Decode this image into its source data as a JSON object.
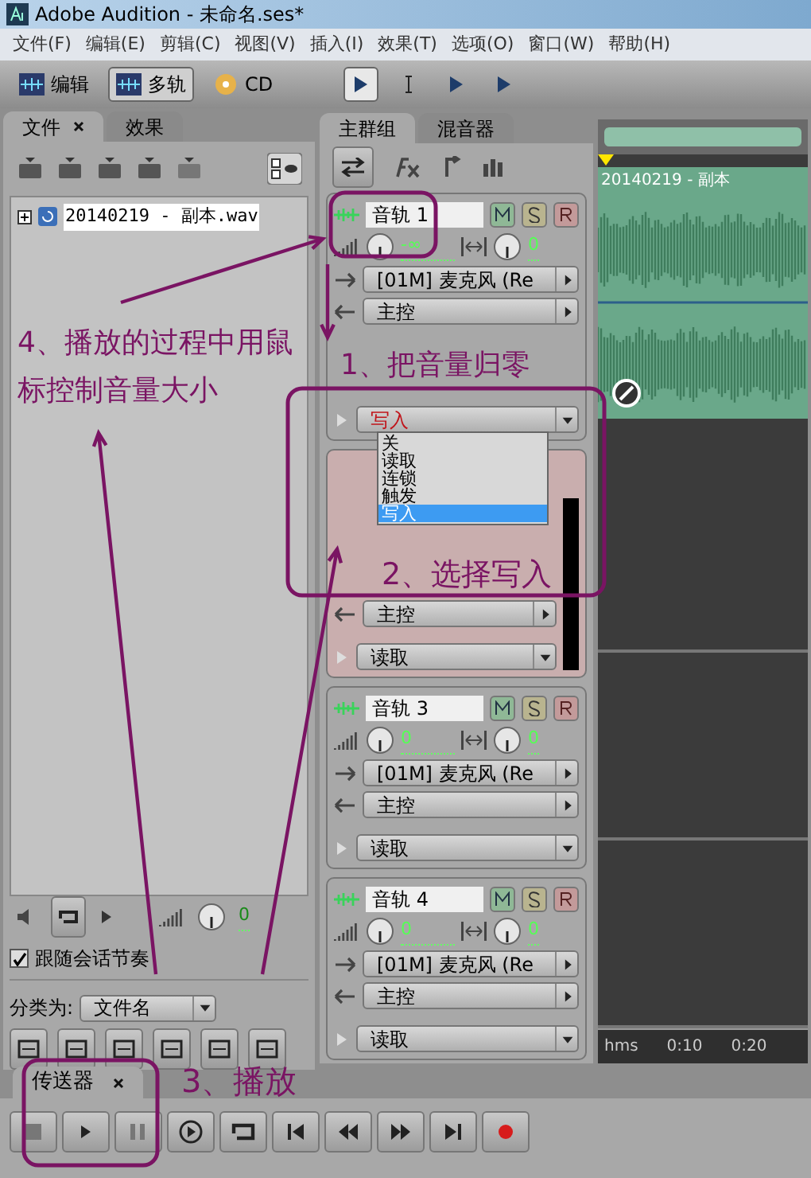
{
  "window": {
    "title": "Adobe Audition - 未命名.ses*"
  },
  "menu": [
    "文件(F)",
    "编辑(E)",
    "剪辑(C)",
    "视图(V)",
    "插入(I)",
    "效果(T)",
    "选项(O)",
    "窗口(W)",
    "帮助(H)"
  ],
  "workspaces": [
    {
      "label": "编辑",
      "selected": false
    },
    {
      "label": "多轨",
      "selected": true
    },
    {
      "label": "CD",
      "selected": false
    }
  ],
  "tools": [
    {
      "selected": true
    },
    {
      "selected": false
    },
    {
      "selected": false
    },
    {
      "selected": false
    }
  ],
  "files_panel": {
    "tabs": [
      {
        "label": "文件",
        "selected": true
      },
      {
        "label": "效果",
        "selected": false
      }
    ],
    "files": [
      {
        "name": "20140219 - 副本.wav",
        "expanded": false
      }
    ],
    "annotation": "4、播放的过程中用鼠标控制音量大小",
    "preview_volume": "0",
    "follow_tempo": {
      "label": "跟随会话节奏",
      "checked": true
    },
    "sort": {
      "label": "分类为:",
      "value": "文件名"
    }
  },
  "tracks_panel": {
    "tabs": [
      {
        "label": "主群组",
        "selected": true
      },
      {
        "label": "混音器",
        "selected": false
      }
    ],
    "tracks": [
      {
        "name": "音轨 1",
        "volume": "-∞",
        "pan": "0",
        "input": "[01M] 麦克风 (Re",
        "output": "主控",
        "annotation": "1、把音量归零",
        "automation": "写入",
        "writing": true,
        "selected": false,
        "expanded": true
      },
      {
        "annotation": "2、选择写入",
        "output": "主控",
        "automation": "读取",
        "writing": false,
        "selected": true,
        "expanded": false
      },
      {
        "name": "音轨 3",
        "volume": "0",
        "pan": "0",
        "input": "[01M] 麦克风 (Re",
        "output": "主控",
        "automation": "读取",
        "writing": false,
        "selected": false,
        "expanded": false
      },
      {
        "name": "音轨 4",
        "volume": "0",
        "pan": "0",
        "input": "[01M] 麦克风 (Re",
        "output": "主控",
        "automation": "读取",
        "writing": false,
        "selected": false,
        "expanded": false
      }
    ],
    "automation_menu": [
      {
        "label": "关",
        "selected": false
      },
      {
        "label": "读取",
        "selected": false
      },
      {
        "label": "连锁",
        "selected": false
      },
      {
        "label": "触发",
        "selected": false
      },
      {
        "label": "写入",
        "selected": true
      }
    ]
  },
  "timeline": {
    "clips": [
      {
        "name": "20140219 - 副本"
      }
    ],
    "ruler": [
      "hms",
      "0:10",
      "0:20"
    ]
  },
  "transport": {
    "tab": "传送器",
    "annotation": "3、播放",
    "record_armed": true
  }
}
